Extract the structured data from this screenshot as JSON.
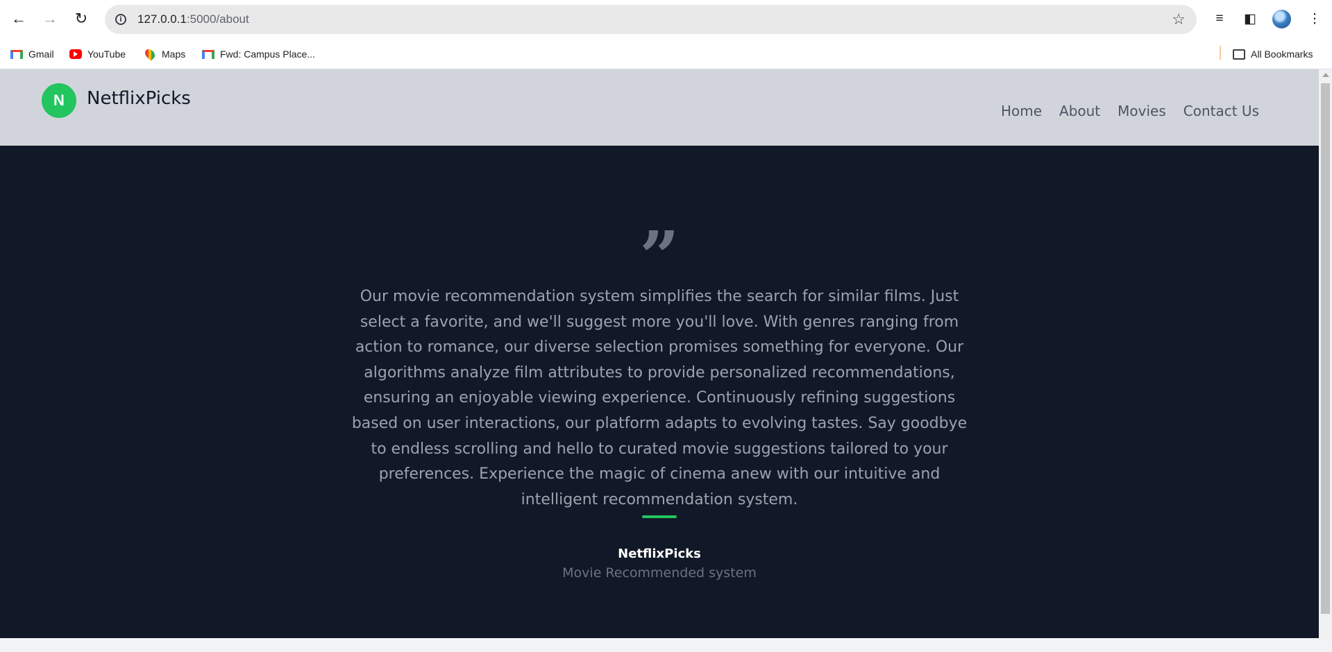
{
  "browser": {
    "url_host": "127.0.0.1",
    "url_path": ":5000/about",
    "back_icon": "←",
    "forward_icon": "→",
    "reload_icon": "↻",
    "star_icon": "☆",
    "menu_icon": "⋮",
    "media_icon": "≡",
    "sidepanel_icon": "◧"
  },
  "bookmarks": {
    "items": [
      {
        "label": "Gmail"
      },
      {
        "label": "YouTube"
      },
      {
        "label": "Maps"
      },
      {
        "label": "Fwd: Campus Place..."
      }
    ],
    "all_bookmarks": "All Bookmarks"
  },
  "site": {
    "logo_letter": "N",
    "brand": "NetflixPicks",
    "nav": [
      "Home",
      "About",
      "Movies",
      "Contact Us"
    ],
    "accent_color": "#22c55e"
  },
  "about": {
    "quote_mark": "”",
    "quote": "Our movie recommendation system simplifies the search for similar films. Just select a favorite, and we'll suggest more you'll love. With genres ranging from action to romance, our diverse selection promises something for everyone. Our algorithms analyze film attributes to provide personalized recommendations, ensuring an enjoyable viewing experience. Continuously refining suggestions based on user interactions, our platform adapts to evolving tastes. Say goodbye to endless scrolling and hello to curated movie suggestions tailored to your preferences. Experience the magic of cinema anew with our intuitive and intelligent recommendation system.",
    "author": "NetflixPicks",
    "author_subtitle": "Movie Recommended system"
  }
}
